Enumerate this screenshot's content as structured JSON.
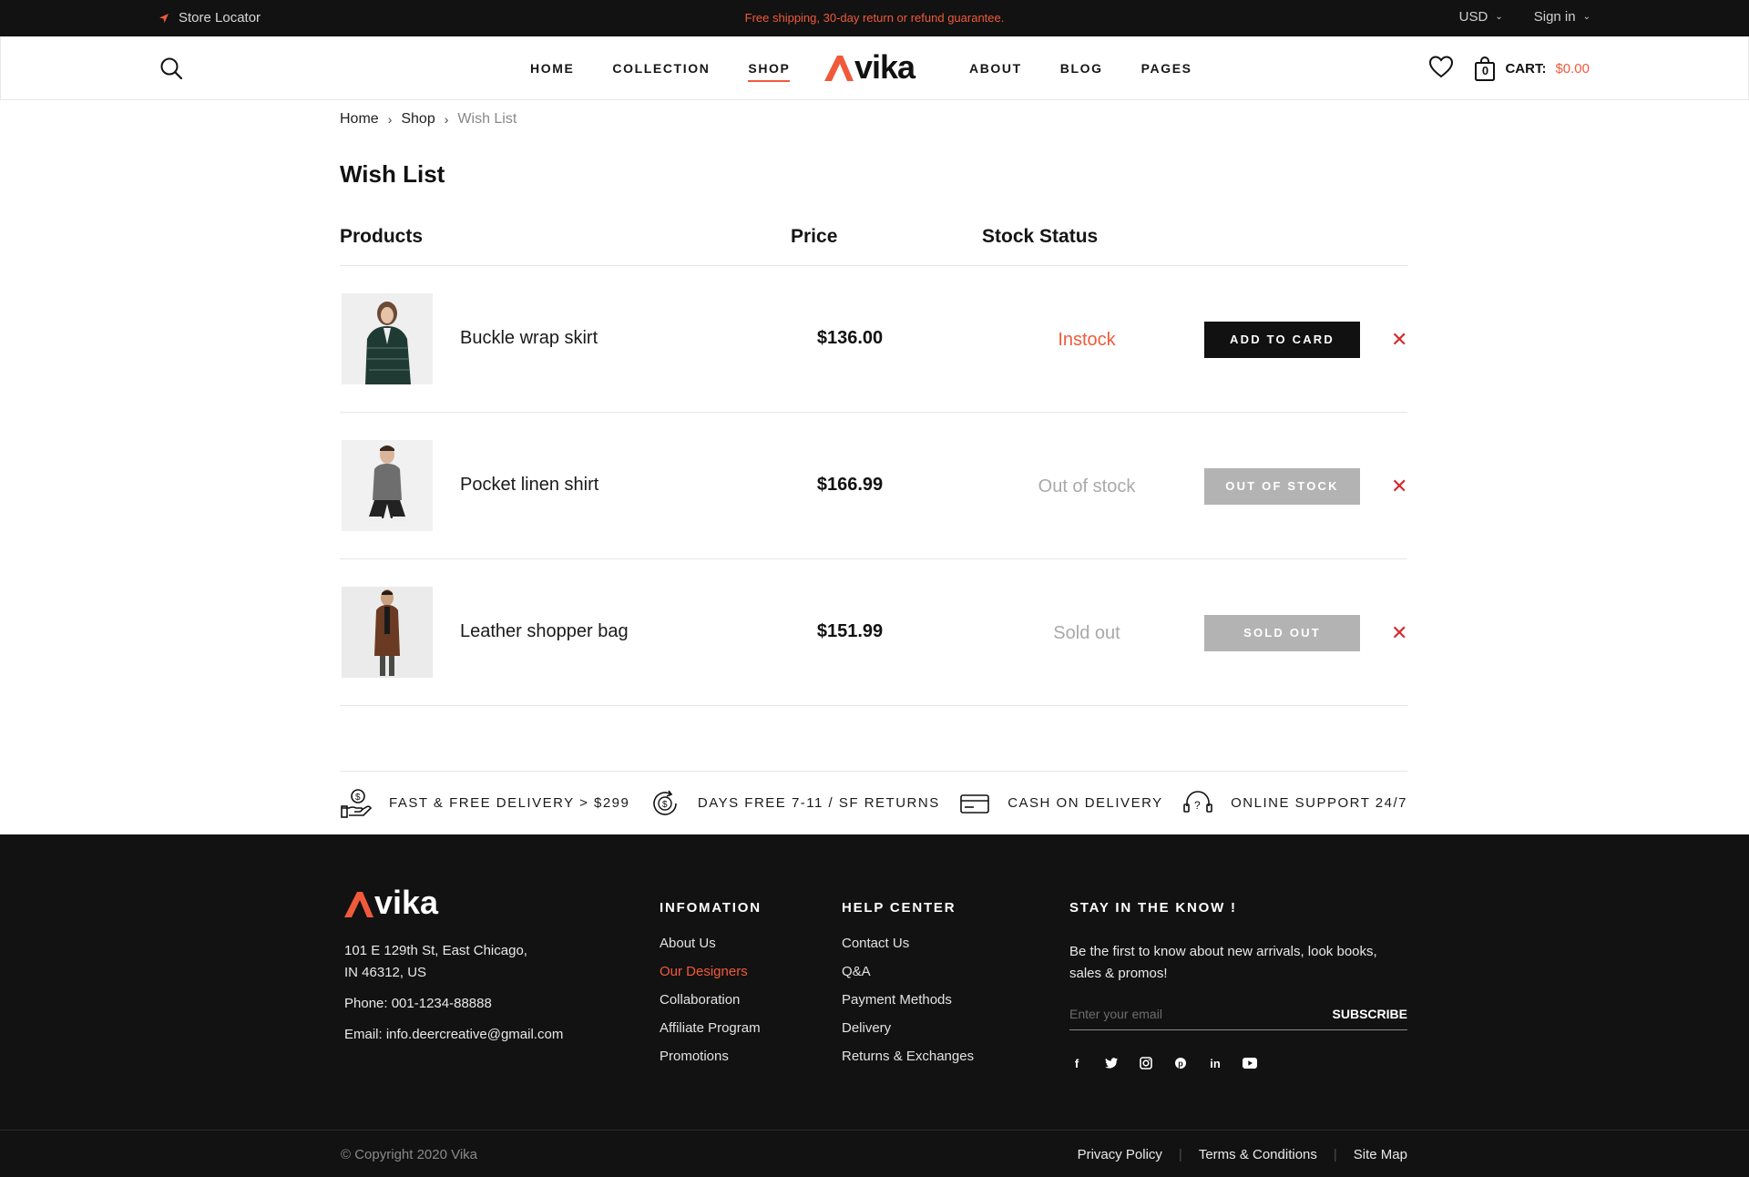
{
  "topbar": {
    "store_locator": "Store Locator",
    "promo": "Free shipping, 30-day return or refund guarantee.",
    "currency": "USD",
    "signin": "Sign in"
  },
  "nav": {
    "left": [
      "HOME",
      "COLLECTION",
      "SHOP"
    ],
    "right": [
      "ABOUT",
      "BLOG",
      "PAGES"
    ],
    "active": "SHOP"
  },
  "brand": {
    "name": "vika",
    "accent": "#f05a3b",
    "dark": "#121212"
  },
  "cart": {
    "count": "0",
    "label": "CART:",
    "amount": "$0.00"
  },
  "breadcrumb": [
    "Home",
    "Shop",
    "Wish List"
  ],
  "page_title": "Wish List",
  "table": {
    "headers": {
      "products": "Products",
      "price": "Price",
      "stock": "Stock Status"
    },
    "rows": [
      {
        "name": "Buckle wrap skirt",
        "price": "$136.00",
        "status": "Instock",
        "button": "ADD TO CARD",
        "status_kind": "in"
      },
      {
        "name": "Pocket linen shirt",
        "price": "$166.99",
        "status": "Out of stock",
        "button": "OUT OF STOCK",
        "status_kind": "out"
      },
      {
        "name": "Leather shopper bag",
        "price": "$151.99",
        "status": "Sold out",
        "button": "SOLD OUT",
        "status_kind": "out"
      }
    ]
  },
  "features": [
    {
      "icon": "money-hand-icon",
      "label": "FAST & FREE DELIVERY > $299"
    },
    {
      "icon": "returns-cycle-icon",
      "label": "DAYS FREE 7-11 / SF RETURNS"
    },
    {
      "icon": "credit-card-icon",
      "label": "CASH ON DELIVERY"
    },
    {
      "icon": "support-headset-icon",
      "label": "ONLINE SUPPORT 24/7"
    }
  ],
  "footer": {
    "address_line1": "101 E 129th St, East Chicago,",
    "address_line2": "IN 46312, US",
    "phone": "Phone: 001-1234-88888",
    "email": "Email: info.deercreative@gmail.com",
    "info_title": "INFOMATION",
    "info_links": [
      "About Us",
      "Our Designers",
      "Collaboration",
      "Affiliate Program",
      "Promotions"
    ],
    "help_title": "HELP CENTER",
    "help_links": [
      "Contact Us",
      "Q&A",
      "Payment Methods",
      "Delivery",
      "Returns & Exchanges"
    ],
    "news_title": "STAY IN THE KNOW !",
    "news_text": "Be the first to know about new arrivals, look books, sales & promos!",
    "email_placeholder": "Enter your email",
    "subscribe": "SUBSCRIBE",
    "socials": [
      "facebook-icon",
      "twitter-icon",
      "instagram-icon",
      "pinterest-icon",
      "linkedin-icon",
      "youtube-icon"
    ],
    "copyright": "© Copyright 2020 Vika",
    "bottom_links": [
      "Privacy Policy",
      "Terms & Conditions",
      "Site Map"
    ]
  }
}
